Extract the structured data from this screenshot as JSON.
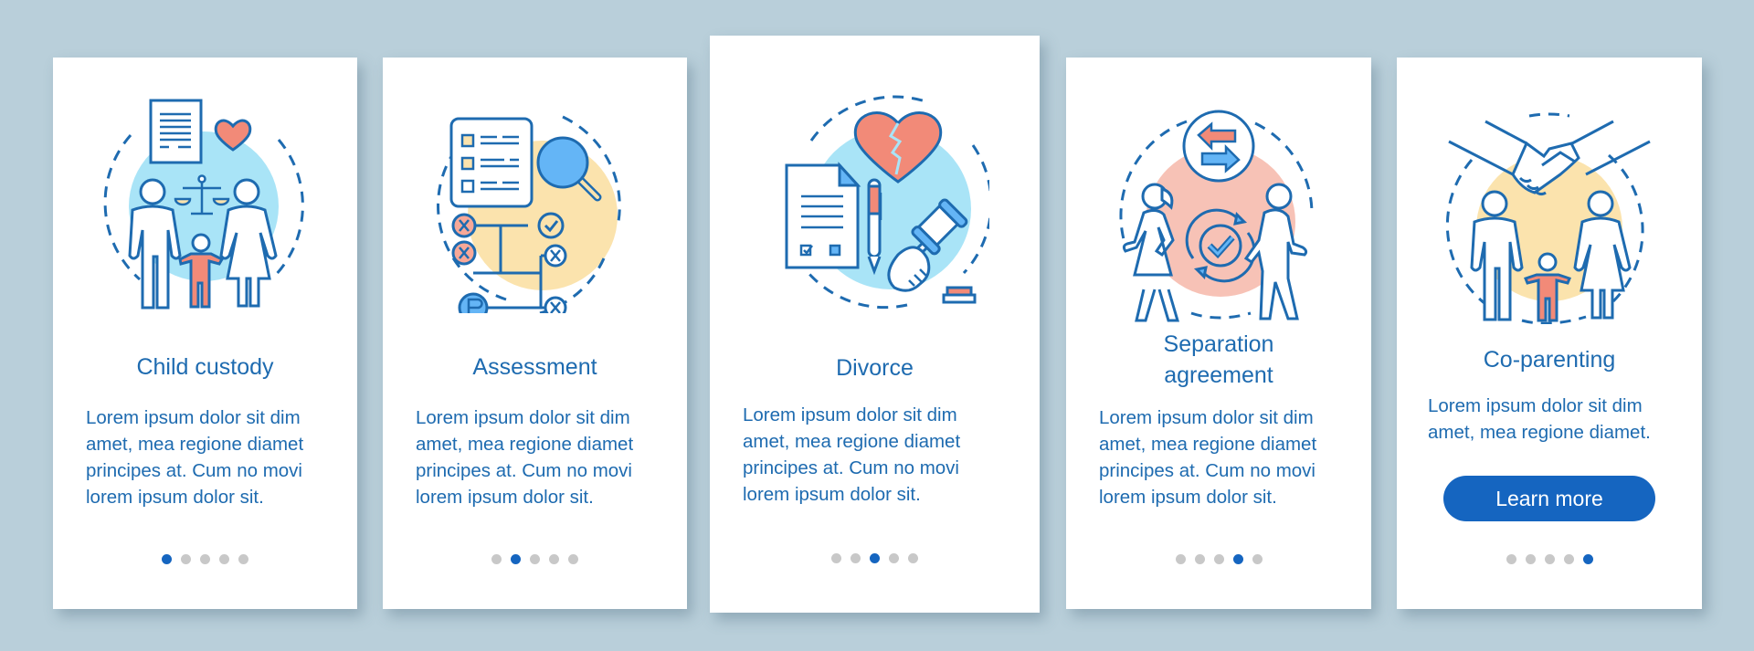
{
  "colors": {
    "background": "#B9CFDA",
    "card": "#FFFFFF",
    "accent": "#1565C0",
    "text": "#1E6BB0",
    "dot_inactive": "#C8C8C8",
    "illus_blue_bg": "#A9E4F7",
    "illus_yellow_bg": "#FBE3AD",
    "illus_pink_bg": "#F7C2B6",
    "illus_coral": "#F28A78",
    "illus_stroke": "#1E6BB0"
  },
  "pagination": {
    "total": 5
  },
  "cards": [
    {
      "title_lines": [
        "Child custody"
      ],
      "body_lines": [
        "Lorem ipsum dolor sit dim",
        "amet, mea regione diamet",
        "principes at. Cum no movi",
        "lorem ipsum dolor sit."
      ],
      "illustration": "child-custody-illustration",
      "active_page": 1
    },
    {
      "title_lines": [
        "Assessment"
      ],
      "body_lines": [
        "Lorem ipsum dolor sit dim",
        "amet, mea regione diamet",
        "principes at. Cum no movi",
        "lorem ipsum dolor sit."
      ],
      "illustration": "assessment-illustration",
      "active_page": 2
    },
    {
      "title_lines": [
        "Divorce"
      ],
      "body_lines": [
        "Lorem ipsum dolor sit dim",
        "amet, mea regione diamet",
        "principes at. Cum no movi",
        "lorem ipsum dolor sit."
      ],
      "illustration": "divorce-illustration",
      "active_page": 3
    },
    {
      "title_lines": [
        "Separation",
        "agreement"
      ],
      "body_lines": [
        "Lorem ipsum dolor sit dim",
        "amet, mea regione diamet",
        "principes at. Cum no movi",
        "lorem ipsum dolor sit."
      ],
      "illustration": "separation-agreement-illustration",
      "active_page": 4
    },
    {
      "title_lines": [
        "Co-parenting"
      ],
      "body_lines": [
        "Lorem ipsum dolor sit dim",
        "amet, mea regione diamet."
      ],
      "illustration": "co-parenting-illustration",
      "active_page": 5,
      "button_label": "Learn more"
    }
  ]
}
